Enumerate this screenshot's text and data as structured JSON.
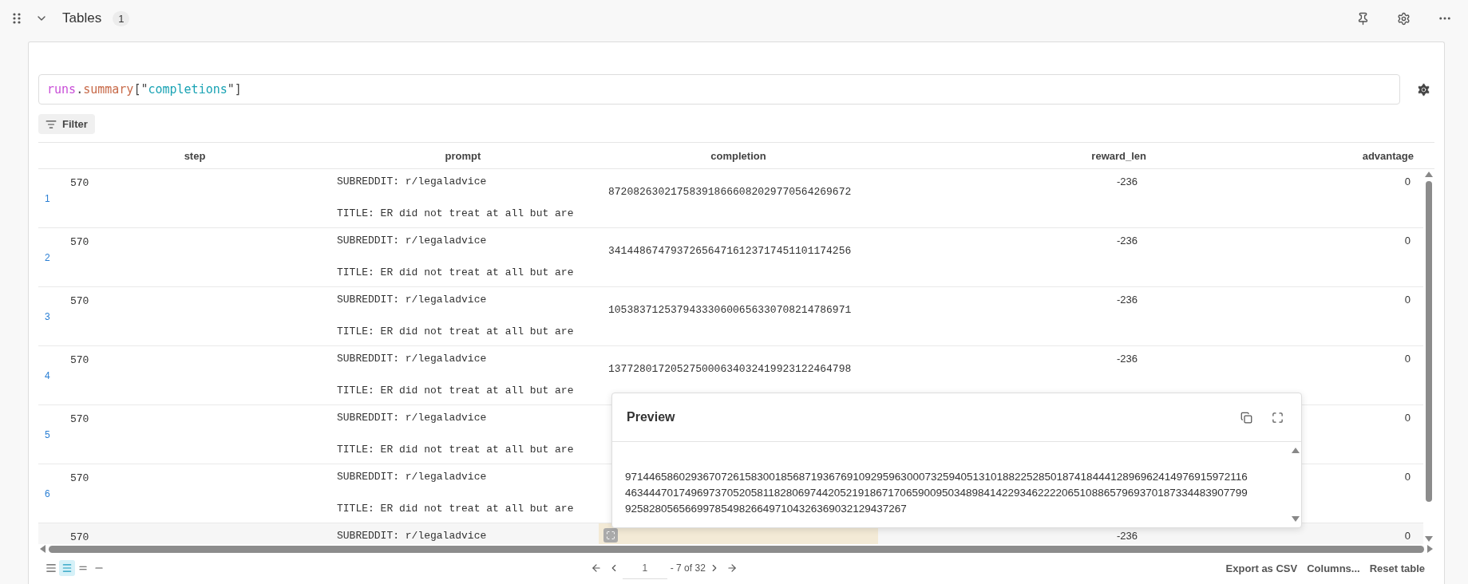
{
  "section": {
    "title": "Tables",
    "count": "1"
  },
  "query": {
    "parts": [
      {
        "kind": "ident",
        "text": "runs"
      },
      {
        "kind": "punct",
        "text": "."
      },
      {
        "kind": "member",
        "text": "summary"
      },
      {
        "kind": "punct",
        "text": "[\""
      },
      {
        "kind": "string",
        "text": "completions"
      },
      {
        "kind": "punct",
        "text": "\"]"
      }
    ]
  },
  "filter_button": "Filter",
  "table": {
    "columns": [
      {
        "label": "step"
      },
      {
        "label": "prompt"
      },
      {
        "label": "completion"
      },
      {
        "label": "reward_len"
      },
      {
        "label": "advantage"
      }
    ],
    "rows": [
      {
        "index": "1",
        "step": "570",
        "prompt": "SUBREDDIT: r/legaladvice\n\nTITLE: ER did not treat at all but are",
        "completion": "872082630217583918666082029770564269672",
        "reward_len": "-236",
        "advantage": "0",
        "hovered": false
      },
      {
        "index": "2",
        "step": "570",
        "prompt": "SUBREDDIT: r/legaladvice\n\nTITLE: ER did not treat at all but are",
        "completion": "341448674793726564716123717451101174256",
        "reward_len": "-236",
        "advantage": "0",
        "hovered": false
      },
      {
        "index": "3",
        "step": "570",
        "prompt": "SUBREDDIT: r/legaladvice\n\nTITLE: ER did not treat at all but are",
        "completion": "105383712537943330600656330708214786971",
        "reward_len": "-236",
        "advantage": "0",
        "hovered": false
      },
      {
        "index": "4",
        "step": "570",
        "prompt": "SUBREDDIT: r/legaladvice\n\nTITLE: ER did not treat at all but are",
        "completion": "137728017205275000634032419923122464798",
        "reward_len": "-236",
        "advantage": "0",
        "hovered": false
      },
      {
        "index": "5",
        "step": "570",
        "prompt": "SUBREDDIT: r/legaladvice\n\nTITLE: ER did not treat at all but are",
        "advantage": "0",
        "hovered": false
      },
      {
        "index": "6",
        "step": "570",
        "prompt": "SUBREDDIT: r/legaladvice\n\nTITLE: ER did not treat at all but are",
        "advantage": "0",
        "hovered": false
      },
      {
        "step": "570",
        "prompt": "SUBREDDIT: r/legaladvice",
        "reward_len": "-236",
        "advantage": "0",
        "hovered": true
      }
    ]
  },
  "preview": {
    "title": "Preview",
    "text": "97144658602936707261583001856871936769109295963000732594051310188225285018741844412896962414976915972116\n46344470174969737052058118280697442052191867170659009503489841422934622220651088657969370187334483907799\n92582805656699785498266497104326369032129437267"
  },
  "pagination": {
    "page": "1",
    "total": "- 7 of 32"
  },
  "density": [
    {
      "selected": false
    },
    {
      "selected": true
    },
    {
      "selected": false
    },
    {
      "selected": false
    }
  ],
  "footer_actions": [
    "Export as CSV",
    "Columns...",
    "Reset table"
  ]
}
